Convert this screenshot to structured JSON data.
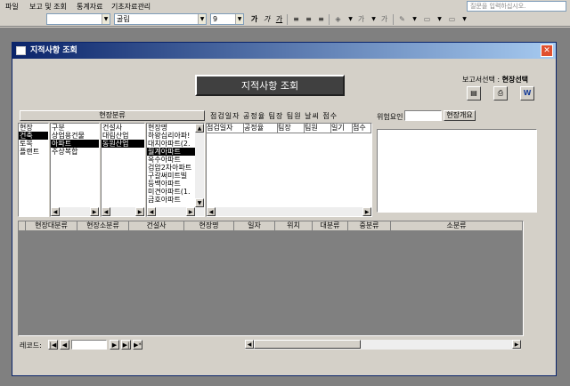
{
  "menu": {
    "items": [
      "파일",
      "보고 및 조회",
      "통계자료",
      "기초자료관리"
    ],
    "help_placeholder": "질문을 입력하십시오."
  },
  "toolbar": {
    "style_value": "",
    "font_value": "굴림",
    "size_value": "9",
    "bold": "가",
    "italic": "가",
    "underline": "가"
  },
  "window": {
    "title": "지적사항 조회"
  },
  "header": {
    "title": "지적사항 조회",
    "report_label": "보고서선택 :",
    "report_value": "현장선택"
  },
  "site_class": {
    "title": "현장분류",
    "list1": [
      "현장",
      "건축",
      "토목",
      "플랜트"
    ],
    "list1_selected": 1,
    "list2": [
      "구분",
      "상업용건물",
      "아파트",
      "주상복합"
    ],
    "list2_selected": 2,
    "list3": [
      "건설사",
      "대림산업",
      "동원산업"
    ],
    "list3_selected": 2,
    "list4": [
      "현장명",
      "하왕십리아파!",
      "대치아파트(2.",
      "월계아파트",
      "옥수아파트",
      "검암2차아파트",
      "구갈써미트빌",
      "등백아파트",
      "미견아파트(1.",
      "금호아파트"
    ],
    "list4_selected": 3
  },
  "inspection": {
    "title": "점검일자 공정율 팀장 팀원 날씨 점수",
    "columns": [
      "점검일자",
      "공정율",
      "팀장",
      "팀원",
      "일기",
      "점수"
    ]
  },
  "risk": {
    "label": "위험요인",
    "button": "현장개요"
  },
  "grid": {
    "columns": [
      "현장대분류",
      "현장소분류",
      "건설사",
      "현장명",
      "일자",
      "위치",
      "대분류",
      "중분류",
      "소분류"
    ]
  },
  "nav": {
    "label": "레코드:",
    "record": ""
  }
}
